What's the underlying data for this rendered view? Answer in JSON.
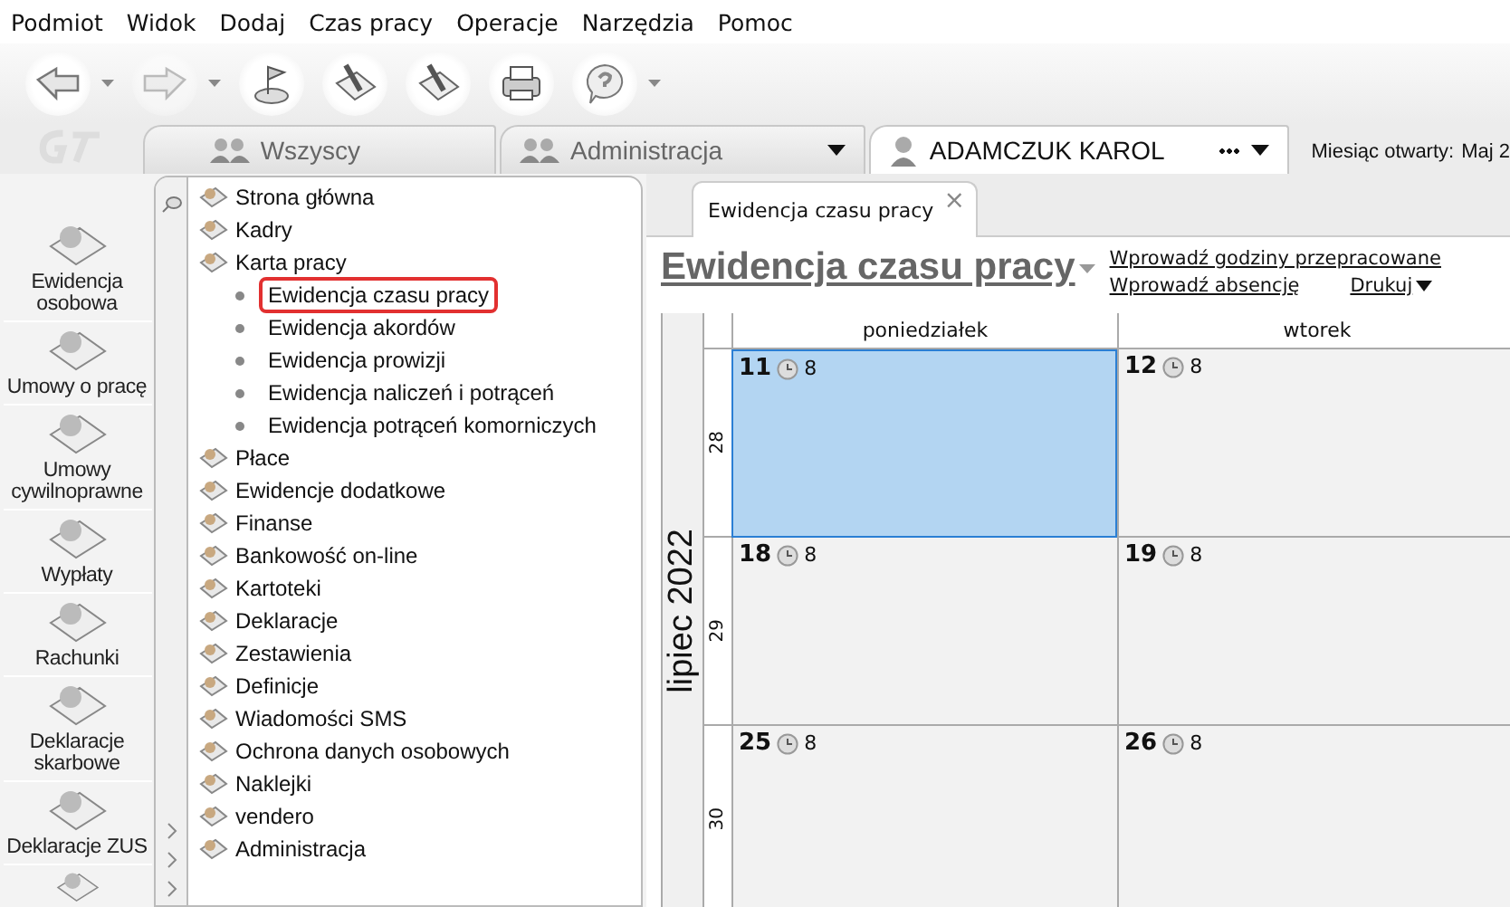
{
  "menu": [
    "Podmiot",
    "Widok",
    "Dodaj",
    "Czas pracy",
    "Operacje",
    "Narzędzia",
    "Pomoc"
  ],
  "toolbar": [
    {
      "kind": "back",
      "dropdown": true,
      "disabled": false
    },
    {
      "kind": "forward",
      "dropdown": true,
      "disabled": true
    },
    {
      "kind": "flag",
      "dropdown": false,
      "disabled": false
    },
    {
      "kind": "edit",
      "dropdown": false,
      "disabled": false
    },
    {
      "kind": "edit",
      "dropdown": false,
      "disabled": false
    },
    {
      "kind": "print",
      "dropdown": false,
      "disabled": false
    },
    {
      "kind": "help",
      "dropdown": true,
      "disabled": false
    }
  ],
  "context_tabs": [
    {
      "label": "Wszyscy",
      "kind": "group",
      "dropdown": false,
      "more": false,
      "selected": false
    },
    {
      "label": "Administracja",
      "kind": "group",
      "dropdown": true,
      "more": false,
      "selected": false
    },
    {
      "label": "ADAMCZUK KAROL",
      "kind": "person",
      "dropdown": true,
      "more": true,
      "selected": true
    }
  ],
  "open_month": {
    "label": "Miesiąc otwarty:",
    "value": "Maj 2"
  },
  "sidebar": [
    {
      "label": "Ewidencja osobowa"
    },
    {
      "label": "Umowy o pracę"
    },
    {
      "label": "Umowy cywilnoprawne"
    },
    {
      "label": "Wypłaty"
    },
    {
      "label": "Rachunki"
    },
    {
      "label": "Deklaracje skarbowe"
    },
    {
      "label": "Deklaracje ZUS"
    }
  ],
  "tree": [
    {
      "label": "Strona główna"
    },
    {
      "label": "Kadry"
    },
    {
      "label": "Karta pracy",
      "children": [
        {
          "label": "Ewidencja czasu pracy",
          "selected": true
        },
        {
          "label": "Ewidencja akordów",
          "selected": false
        },
        {
          "label": "Ewidencja prowizji",
          "selected": false
        },
        {
          "label": "Ewidencja naliczeń i potrąceń",
          "selected": false
        },
        {
          "label": "Ewidencja potrąceń komorniczych",
          "selected": false
        }
      ]
    },
    {
      "label": "Płace"
    },
    {
      "label": "Ewidencje dodatkowe"
    },
    {
      "label": "Finanse"
    },
    {
      "label": "Bankowość on-line"
    },
    {
      "label": "Kartoteki"
    },
    {
      "label": "Deklaracje"
    },
    {
      "label": "Zestawienia"
    },
    {
      "label": "Definicje"
    },
    {
      "label": "Wiadomości SMS"
    },
    {
      "label": "Ochrona danych osobowych"
    },
    {
      "label": "Naklejki"
    },
    {
      "label": "vendero"
    },
    {
      "label": "Administracja"
    }
  ],
  "document_tab": {
    "label": "Ewidencja czasu pracy",
    "close": "×"
  },
  "heading": "Ewidencja czasu pracy",
  "links": [
    "Wprowadź godziny przepracowane",
    "Wprowadź absencję"
  ],
  "print_menu": "Drukuj",
  "calendar": {
    "month": "lipiec 2022",
    "days": [
      "poniedziałek",
      "wtorek"
    ],
    "weeks": [
      {
        "week": "28",
        "cells": [
          {
            "day": "11",
            "hours": "8",
            "selected": true
          },
          {
            "day": "12",
            "hours": "8",
            "selected": false
          }
        ]
      },
      {
        "week": "29",
        "cells": [
          {
            "day": "18",
            "hours": "8",
            "selected": false
          },
          {
            "day": "19",
            "hours": "8",
            "selected": false
          }
        ]
      },
      {
        "week": "30",
        "cells": [
          {
            "day": "25",
            "hours": "8",
            "selected": false
          },
          {
            "day": "26",
            "hours": "8",
            "selected": false
          }
        ]
      }
    ]
  }
}
